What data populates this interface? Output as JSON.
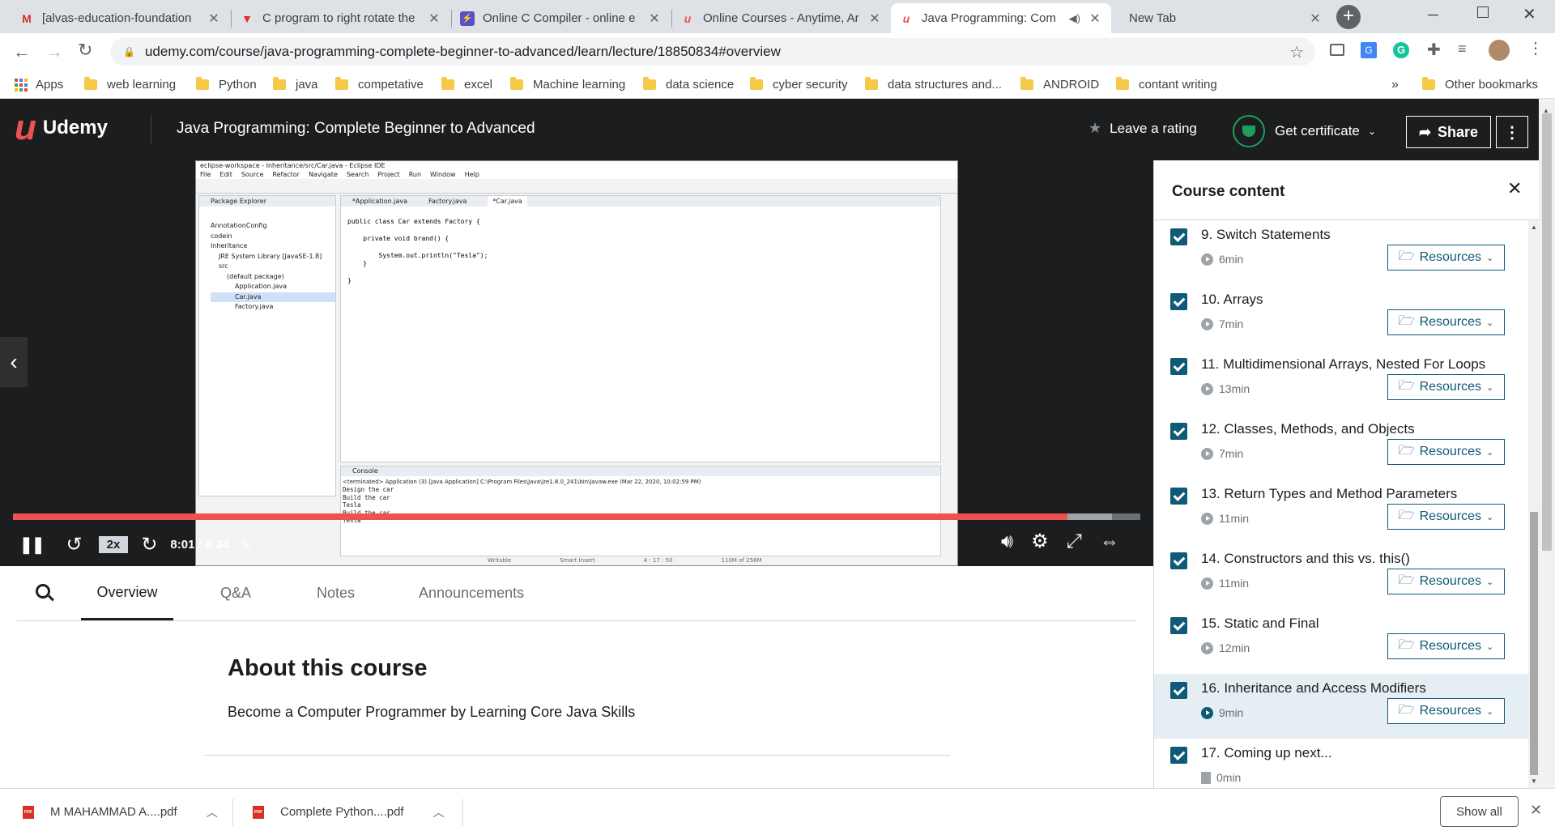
{
  "tabs": [
    {
      "title": "[alvas-education-foundation",
      "icon": "gmail-icon"
    },
    {
      "title": "C program to right rotate the",
      "icon": "tutorial-icon"
    },
    {
      "title": "Online C Compiler - online e",
      "icon": "compiler-icon"
    },
    {
      "title": "Online Courses - Anytime, Ar",
      "icon": "udemy-icon"
    },
    {
      "title": "Java Programming: Com",
      "icon": "udemy-icon"
    },
    {
      "title": "New Tab",
      "icon": ""
    }
  ],
  "toolbar": {
    "url": "udemy.com/course/java-programming-complete-beginner-to-advanced/learn/lecture/18850834#overview"
  },
  "bookmarks": {
    "apps": "Apps",
    "items": [
      "web learning",
      "Python",
      "java",
      "competative",
      "excel",
      "Machine learning",
      "data science",
      "cyber security",
      "data structures and...",
      "ANDROID",
      "contant writing"
    ],
    "overflow": "»",
    "other": "Other bookmarks"
  },
  "header": {
    "logo": "Udemy",
    "course_title": "Java Programming: Complete Beginner to Advanced",
    "rating": "Leave a rating",
    "certificate": "Get certificate",
    "share": "Share"
  },
  "eclipse": {
    "title": "eclipse-workspace - Inheritance/src/Car.java - Eclipse IDE",
    "menu": [
      "File",
      "Edit",
      "Source",
      "Refactor",
      "Navigate",
      "Search",
      "Project",
      "Run",
      "Window",
      "Help"
    ],
    "explorer_title": "Package Explorer",
    "tree": [
      "AnnotationConfig",
      "codein",
      "Inheritance",
      "JRE System Library [JavaSE-1.8]",
      "src",
      "(default package)",
      "Application.java",
      "Car.java",
      "Factory.java"
    ],
    "editor_tabs": [
      "*Application.java",
      "Factory.java",
      "*Car.java"
    ],
    "code": [
      "",
      "public class Car extends Factory {",
      "",
      "    private void brand() {",
      "",
      "        System.out.println(\"Tesla\");",
      "    }",
      "",
      "}",
      ""
    ],
    "console_title": "Console",
    "console_header": "<terminated> Application (3) [Java Application] C:\\Program Files\\Java\\jre1.8.0_241\\bin\\javaw.exe (Mar 22, 2020, 10:02:59 PM)",
    "console_lines": [
      "Design the car",
      "Build the car",
      "Tesla",
      "Build the car",
      "Tesla"
    ],
    "status": [
      "Writable",
      "Smart Insert",
      "4 : 17 : 50",
      "110M of 256M"
    ]
  },
  "player": {
    "speed": "2x",
    "time": "8:01 / 8:34",
    "progress": 0.935,
    "buffered": 0.975
  },
  "lower_tabs": [
    "Overview",
    "Q&A",
    "Notes",
    "Announcements"
  ],
  "about": {
    "heading": "About this course",
    "text": "Become a Computer Programmer by Learning Core Java Skills"
  },
  "sidebar": {
    "title": "Course content",
    "resources_label": "Resources",
    "items": [
      {
        "title": "9. Switch Statements",
        "duration": "6min"
      },
      {
        "title": "10. Arrays",
        "duration": "7min"
      },
      {
        "title": "11. Multidimensional Arrays, Nested For Loops",
        "duration": "13min"
      },
      {
        "title": "12. Classes, Methods, and Objects",
        "duration": "7min"
      },
      {
        "title": "13. Return Types and Method Parameters",
        "duration": "11min"
      },
      {
        "title": "14. Constructors and this vs. this()",
        "duration": "11min"
      },
      {
        "title": "15. Static and Final",
        "duration": "12min"
      },
      {
        "title": "16. Inheritance and Access Modifiers",
        "duration": "9min"
      },
      {
        "title": "17. Coming up next...",
        "duration": "0min"
      }
    ]
  },
  "downloads": {
    "files": [
      "M MAHAMMAD A....pdf",
      "Complete Python....pdf"
    ],
    "show_all": "Show all"
  },
  "colors": {
    "udemy_red": "#ec5252",
    "accent": "#0f5a76",
    "dark": "#1c1d1f",
    "cert_green": "#1e9e5a"
  }
}
